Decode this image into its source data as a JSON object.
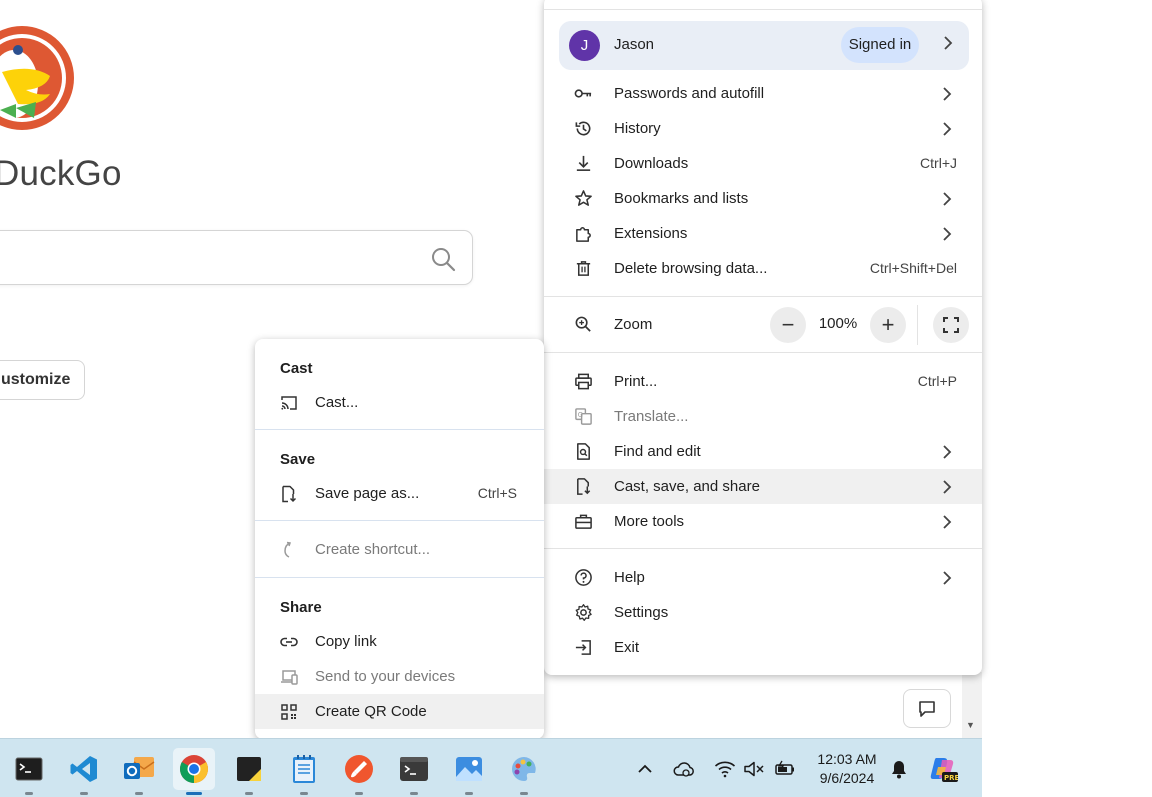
{
  "page": {
    "brand_text": "DuckGo",
    "customize_label": "ustomize"
  },
  "profile": {
    "avatar_letter": "J",
    "name": "Jason",
    "status": "Signed in",
    "avatar_color": "#6034a8"
  },
  "menu": {
    "passwords": "Passwords and autofill",
    "history": "History",
    "downloads": "Downloads",
    "downloads_shortcut": "Ctrl+J",
    "bookmarks": "Bookmarks and lists",
    "extensions": "Extensions",
    "delete_data": "Delete browsing data...",
    "delete_data_shortcut": "Ctrl+Shift+Del",
    "zoom": "Zoom",
    "zoom_minus": "−",
    "zoom_value": "100%",
    "zoom_plus": "+",
    "print": "Print...",
    "print_shortcut": "Ctrl+P",
    "translate": "Translate...",
    "find_edit": "Find and edit",
    "cast_save_share": "Cast, save, and share",
    "more_tools": "More tools",
    "help": "Help",
    "settings": "Settings",
    "exit": "Exit"
  },
  "submenu": {
    "cast_header": "Cast",
    "cast_item": "Cast...",
    "save_header": "Save",
    "save_page": "Save page as...",
    "save_page_shortcut": "Ctrl+S",
    "create_shortcut": "Create shortcut...",
    "share_header": "Share",
    "copy_link": "Copy link",
    "send_devices": "Send to your devices",
    "qr_code": "Create QR Code"
  },
  "taskbar": {
    "apps": [
      "terminal-icon",
      "vscode-icon",
      "outlook-icon",
      "chrome-icon",
      "sticky-notes-icon",
      "notepad-icon",
      "paint-brush-icon",
      "terminal-dark-icon",
      "photos-icon",
      "paint-icon"
    ],
    "time": "12:03 AM",
    "date": "9/6/2024"
  },
  "colors": {
    "menu_highlight": "#f0f0f0",
    "profile_bg": "#e9eef6",
    "signed_pill": "#d3e3fd",
    "taskbar_bg": "#cfe5f0",
    "duck_orange": "#de5833"
  }
}
